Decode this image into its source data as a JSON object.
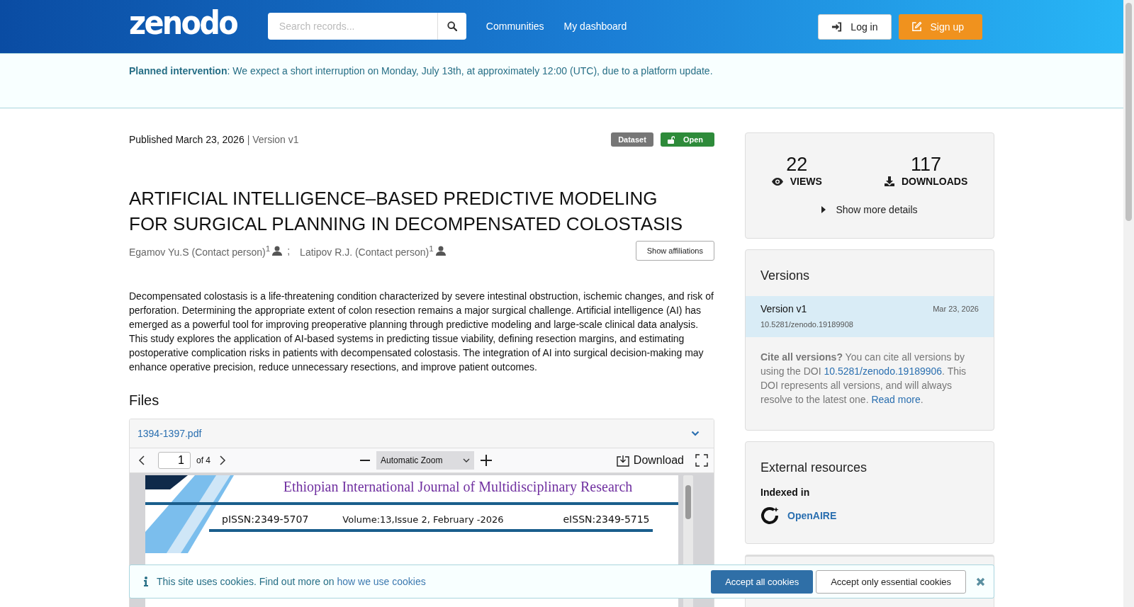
{
  "header": {
    "logo": "zenodo",
    "search": {
      "placeholder": "Search records..."
    },
    "nav": [
      "Communities",
      "My dashboard"
    ],
    "buttons": [
      {
        "label": "Log in",
        "kind": "login"
      },
      {
        "label": "Sign up",
        "kind": "signup"
      }
    ]
  },
  "notice": {
    "label": "Planned intervention",
    "text": ": We expect a short interruption on Monday, July 13th, at approximately 12:00 (UTC), due to a platform update."
  },
  "record": {
    "published": "Published March 23, 2026",
    "version": "| Version v1",
    "badges": [
      {
        "label": "Dataset",
        "kind": "type"
      },
      {
        "label": "Open",
        "kind": "access"
      }
    ],
    "title": "ARTIFICIAL INTELLIGENCE–BASED PREDICTIVE MODELING FOR SURGICAL PLANNING IN DECOMPENSATED COLOSTASIS",
    "creators": [
      {
        "name": "Egamov Yu.S (Contact person)$^{1}$"
      },
      {
        "name": "Latipov R.J. (Contact person)$^{1}$"
      }
    ],
    "creator_separator": ";",
    "show_affiliations": "Show affiliations",
    "abstract": "Decompensated colostasis is a life-threatening condition characterized by severe intestinal obstruction, ischemic changes, and risk of perforation. Determining the appropriate extent of colon resection remains a major surgical challenge. Artificial intelligence (AI) has emerged as a powerful tool for improving preoperative planning through predictive modeling and large-scale clinical data analysis. This study explores the application of AI-based systems in predicting tissue viability, defining resection margins, and estimating postoperative complication risks in patients with decompensated colostasis. The integration of AI into surgical decision-making may enhance operative precision, reduce unnecessary resections, and improve patient outcomes.",
    "files": {
      "heading": "Files",
      "file_name": "1394-1397.pdf",
      "expanded": true,
      "viewer": {
        "page": "1",
        "page_count": "of 4",
        "zoom": "Automatic Zoom",
        "download": "Download",
        "document": {
          "journal": "Ethiopian International Journal of Multidisciplinary Research",
          "pissn": "pISSN:2349-5707",
          "volume": "Volume:13,Issue 2, February -2026",
          "eissn": "eISSN:2349-5715"
        }
      }
    }
  },
  "sidebar": {
    "stats": [
      {
        "value": "22",
        "label": "VIEWS",
        "kind": "views"
      },
      {
        "value": "117",
        "label": "DOWNLOADS",
        "kind": "downloads"
      }
    ],
    "show_more": "Show more details",
    "versions": {
      "title": "Versions",
      "items": [
        {
          "label": "Version v1",
          "date": "Mar 23, 2026",
          "doi": "10.5281/zenodo.19189908",
          "selected": true
        }
      ],
      "cite": {
        "lead": "Cite all versions?",
        "text": " You can cite all versions by using the DOI ",
        "doi": "10.5281/zenodo.19189906",
        "text2": ". This DOI represents all versions, and will always resolve to the latest one. ",
        "read_more": "Read more",
        "end": "."
      }
    },
    "external": {
      "title": "External resources",
      "indexed_in": "Indexed in",
      "items": [
        {
          "name": "OpenAIRE"
        }
      ]
    }
  },
  "cookies": {
    "text": "This site uses cookies. Find out more on ",
    "link": "how we use cookies",
    "buttons": [
      {
        "label": "Accept all cookies",
        "kind": "primary"
      },
      {
        "label": "Accept only essential cookies",
        "kind": "secondary"
      }
    ]
  }
}
